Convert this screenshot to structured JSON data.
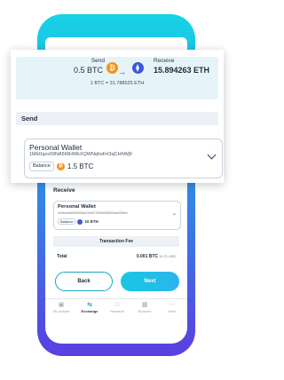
{
  "exchange": {
    "send_label": "Send",
    "send_amount": "0.5 BTC",
    "receive_label": "Receive",
    "receive_amount": "15.894263 ETH",
    "rate": "1 BTC = 31.788525 ETH"
  },
  "send_section": {
    "title": "Send",
    "wallet_name": "Personal Wallet",
    "wallet_address": "1MkDqzx09NA5WHWkXQWNqhsFrt3qCHhWjF",
    "balance_label": "Balance",
    "balance_amount": "1.5 BTC"
  },
  "receive_section": {
    "title": "Receive",
    "wallet_name": "Personal Wallet",
    "wallet_address": "0x9ba46d0b0f40da12b2572f3fd0989f2eac40f9e9",
    "balance_label": "Balance",
    "balance_amount": "10 ETH"
  },
  "fee": {
    "title": "Transaction Fee",
    "total_label": "Total",
    "total_value": "0.001 BTC",
    "total_usd": "10.71 USD"
  },
  "buttons": {
    "back": "Back",
    "next": "Next"
  },
  "tabs": [
    {
      "label": "My Assets",
      "icon": "wallet-icon"
    },
    {
      "label": "Exchange",
      "icon": "swap-icon"
    },
    {
      "label": "Rewards",
      "icon": "gift-icon"
    },
    {
      "label": "Browser",
      "icon": "browser-icon"
    },
    {
      "label": "More",
      "icon": "more-icon"
    }
  ],
  "colors": {
    "accent": "#19a4c7",
    "btc": "#f7931a",
    "eth": "#3d57d8"
  }
}
